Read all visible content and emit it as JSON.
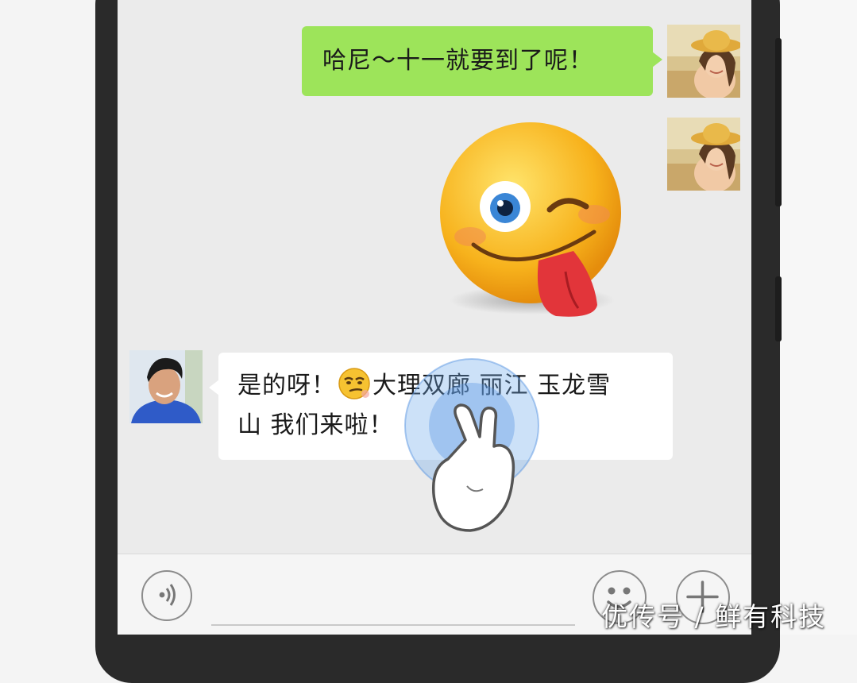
{
  "chat": {
    "messages": [
      {
        "side": "right",
        "type": "text",
        "text": "哈尼～十一就要到了呢！"
      },
      {
        "side": "right",
        "type": "sticker",
        "sticker": "winking-tongue-face"
      },
      {
        "side": "left",
        "type": "text",
        "text_before_emoji": "是的呀！",
        "emoji": "smirk-face",
        "text_after_emoji": "大理双廊 丽江 玉龙雪",
        "text_line2": "山 我们来啦！"
      }
    ]
  },
  "input_bar": {
    "voice_icon": "voice-icon",
    "emoji_icon": "emoji-icon",
    "more_icon": "plus-icon"
  },
  "overlay": {
    "touch_hint_icon": "two-finger-tap-icon"
  },
  "watermark": {
    "text": "优传号 / 鲜有科技"
  },
  "colors": {
    "chat_background": "#ebebeb",
    "sent_bubble": "#9de45a",
    "received_bubble": "#ffffff",
    "phone_frame": "#2a2a2a"
  }
}
